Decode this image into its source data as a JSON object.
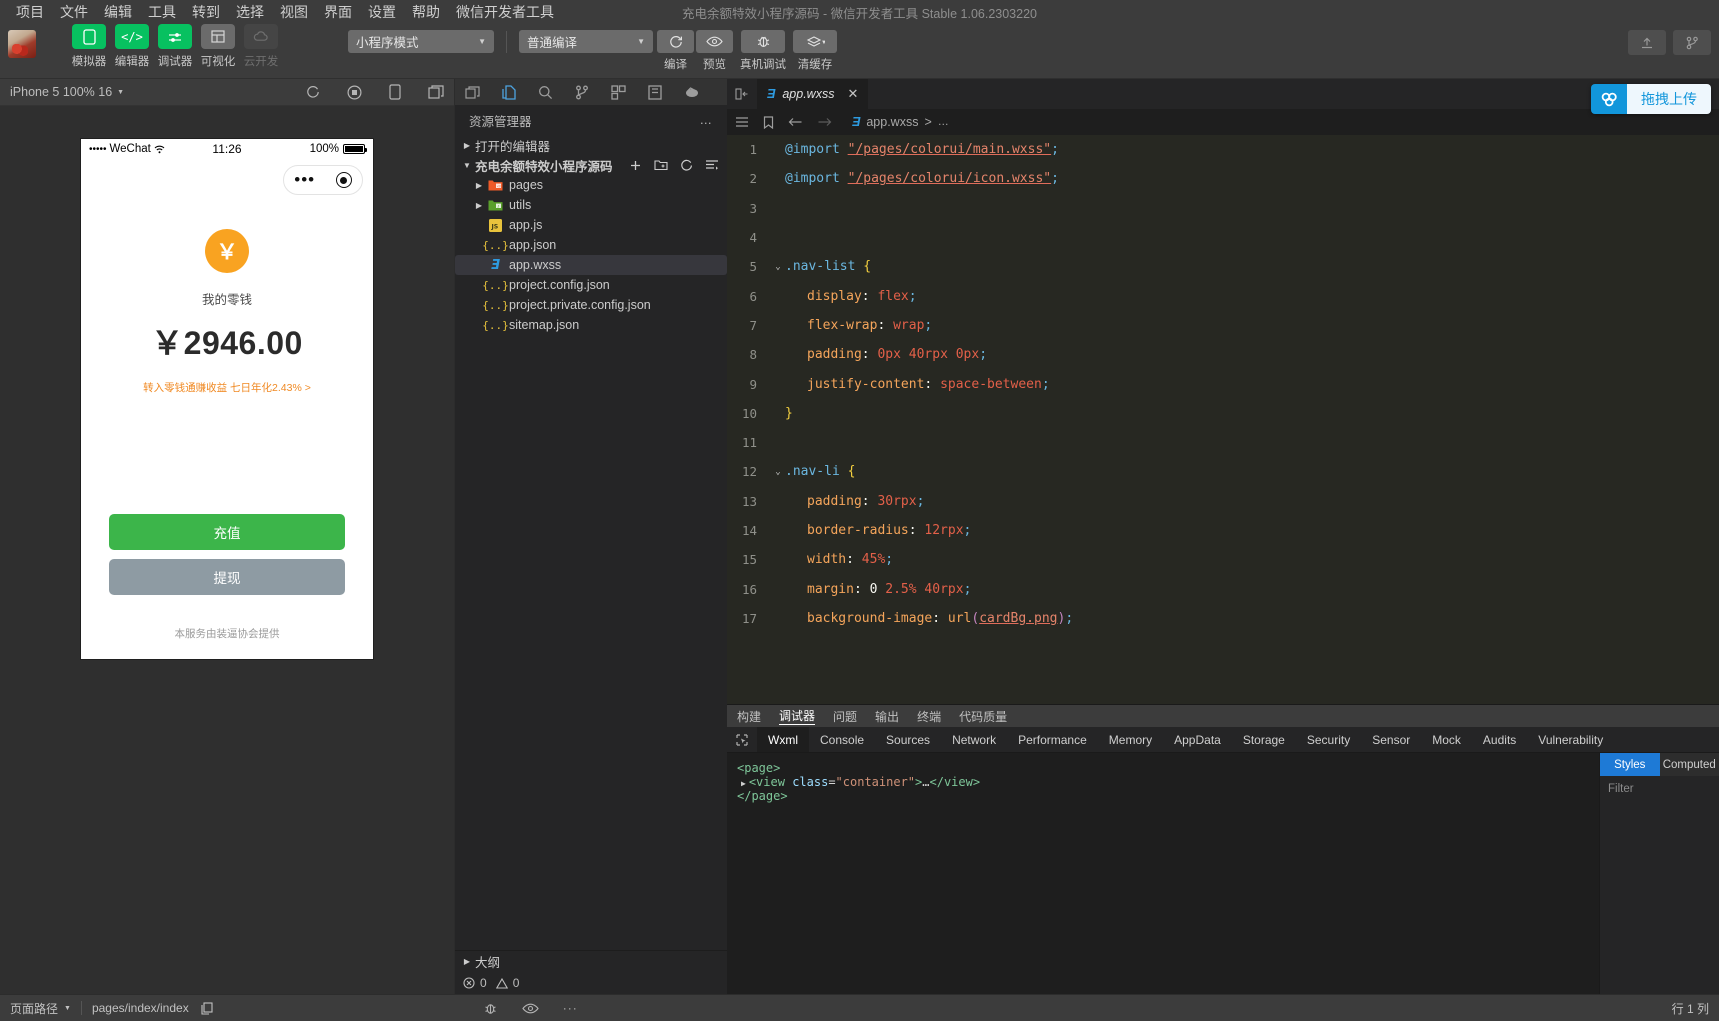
{
  "window": {
    "title": "充电余额特效小程序源码 - 微信开发者工具 Stable 1.06.2303220"
  },
  "menubar": {
    "items": [
      "项目",
      "文件",
      "编辑",
      "工具",
      "转到",
      "选择",
      "视图",
      "界面",
      "设置",
      "帮助",
      "微信开发者工具"
    ]
  },
  "toolbar": {
    "mode_buttons": [
      {
        "label": "模拟器",
        "icon": "phone-icon",
        "state": "active"
      },
      {
        "label": "编辑器",
        "icon": "code-icon",
        "state": "active"
      },
      {
        "label": "调试器",
        "icon": "sliders-icon",
        "state": "active"
      },
      {
        "label": "可视化",
        "icon": "layout-icon",
        "state": "gray"
      },
      {
        "label": "云开发",
        "icon": "cloud-icon",
        "state": "disabled"
      }
    ],
    "mode_select": {
      "value": "小程序模式"
    },
    "compile_select": {
      "value": "普通编译"
    },
    "actions": [
      {
        "label": "编译",
        "icon": "refresh-icon"
      },
      {
        "label": "预览",
        "icon": "eye-icon"
      },
      {
        "label": "真机调试",
        "icon": "bug-icon"
      },
      {
        "label": "清缓存",
        "icon": "layers-icon"
      }
    ],
    "right_icons": [
      "upload-icon",
      "branch-icon"
    ],
    "upload_pill": {
      "label": "拖拽上传",
      "icon": "cloud-upload-icon",
      "accent": "#1296db"
    }
  },
  "simulator": {
    "device": "iPhone 5 100% 16",
    "icons": [
      "refresh-icon",
      "record-icon",
      "rotate-icon",
      "copy-icon"
    ],
    "phone": {
      "status": {
        "carrier": "WeChat",
        "dots": "•••••",
        "time": "11:26",
        "battery": "100%"
      },
      "capsule": {
        "menu": "•••",
        "close": "target-icon"
      },
      "coin_symbol": "￥",
      "label": "我的零钱",
      "amount": "￥2946.00",
      "link": "转入零钱通赚收益 七日年化2.43% >",
      "primary_button": "充值",
      "secondary_button": "提现",
      "footer": "本服务由装逼协会提供",
      "colors": {
        "coin": "#f9a321",
        "primary": "#3cb54a",
        "secondary": "#8e9ba3",
        "link": "#f08a24"
      }
    }
  },
  "explorer": {
    "activity_icons": [
      "files-icon",
      "search-icon",
      "source-control-icon",
      "extensions-icon",
      "wxml-icon",
      "debug-console-icon"
    ],
    "title": "资源管理器",
    "more": "…",
    "sections": [
      {
        "label": "打开的编辑器",
        "expanded": false
      },
      {
        "label": "充电余额特效小程序源码",
        "expanded": true
      }
    ],
    "root_actions": [
      "new-file-icon",
      "new-folder-icon",
      "refresh-icon",
      "collapse-icon"
    ],
    "files": [
      {
        "name": "pages",
        "type": "folder",
        "icon": "folder-pages-icon",
        "indent": 1,
        "expanded": false
      },
      {
        "name": "utils",
        "type": "folder",
        "icon": "folder-utils-icon",
        "indent": 1,
        "expanded": false
      },
      {
        "name": "app.js",
        "type": "file",
        "icon": "js-icon",
        "indent": 1
      },
      {
        "name": "app.json",
        "type": "file",
        "icon": "json-icon",
        "indent": 1
      },
      {
        "name": "app.wxss",
        "type": "file",
        "icon": "wxss-icon",
        "indent": 1,
        "selected": true
      },
      {
        "name": "project.config.json",
        "type": "file",
        "icon": "json-icon",
        "indent": 1
      },
      {
        "name": "project.private.config.json",
        "type": "file",
        "icon": "json-icon",
        "indent": 1
      },
      {
        "name": "sitemap.json",
        "type": "file",
        "icon": "json-icon",
        "indent": 1
      }
    ],
    "outline": {
      "label": "大纲",
      "expanded": false
    },
    "problems": {
      "errors": "0",
      "warnings": "0"
    }
  },
  "editor": {
    "tab": {
      "name": "app.wxss",
      "icon": "wxss-icon",
      "close": "✕"
    },
    "split_icon": "split-editor-icon",
    "breadcrumb_icons": [
      "outline-icon",
      "bookmark-icon",
      "back-arrow-icon",
      "forward-arrow-icon"
    ],
    "breadcrumb": {
      "file": "app.wxss",
      "sep": ">",
      "rest": "…"
    },
    "lines": [
      {
        "n": "1",
        "tokens": [
          {
            "t": "@import",
            "c": "k-at"
          },
          {
            "t": " ",
            "c": "k-val2"
          },
          {
            "t": "\"/pages/colorui/main.wxss\"",
            "c": "k-str"
          },
          {
            "t": ";",
            "c": "k-punc"
          }
        ]
      },
      {
        "n": "2",
        "tokens": [
          {
            "t": "@import",
            "c": "k-at"
          },
          {
            "t": " ",
            "c": "k-val2"
          },
          {
            "t": "\"/pages/colorui/icon.wxss\"",
            "c": "k-str"
          },
          {
            "t": ";",
            "c": "k-punc"
          }
        ]
      },
      {
        "n": "3",
        "tokens": []
      },
      {
        "n": "4",
        "tokens": []
      },
      {
        "n": "5",
        "fold": "⌄",
        "tokens": [
          {
            "t": ".nav-list",
            "c": "k-sel"
          },
          {
            "t": " ",
            "c": "k-val2"
          },
          {
            "t": "{",
            "c": "k-brace"
          }
        ]
      },
      {
        "n": "6",
        "indent": 1,
        "tokens": [
          {
            "t": "display",
            "c": "k-prop"
          },
          {
            "t": ": ",
            "c": "k-val2"
          },
          {
            "t": "flex",
            "c": "k-val"
          },
          {
            "t": ";",
            "c": "k-punc"
          }
        ]
      },
      {
        "n": "7",
        "indent": 1,
        "tokens": [
          {
            "t": "flex-wrap",
            "c": "k-prop"
          },
          {
            "t": ": ",
            "c": "k-val2"
          },
          {
            "t": "wrap",
            "c": "k-val"
          },
          {
            "t": ";",
            "c": "k-punc"
          }
        ]
      },
      {
        "n": "8",
        "indent": 1,
        "tokens": [
          {
            "t": "padding",
            "c": "k-prop"
          },
          {
            "t": ": ",
            "c": "k-val2"
          },
          {
            "t": "0px 40rpx 0px",
            "c": "k-num"
          },
          {
            "t": ";",
            "c": "k-punc"
          }
        ]
      },
      {
        "n": "9",
        "indent": 1,
        "tokens": [
          {
            "t": "justify-content",
            "c": "k-prop"
          },
          {
            "t": ": ",
            "c": "k-val2"
          },
          {
            "t": "space-between",
            "c": "k-val"
          },
          {
            "t": ";",
            "c": "k-punc"
          }
        ]
      },
      {
        "n": "10",
        "tokens": [
          {
            "t": "}",
            "c": "k-brace"
          }
        ]
      },
      {
        "n": "11",
        "tokens": []
      },
      {
        "n": "12",
        "fold": "⌄",
        "tokens": [
          {
            "t": ".nav-li",
            "c": "k-sel"
          },
          {
            "t": " ",
            "c": "k-val2"
          },
          {
            "t": "{",
            "c": "k-brace"
          }
        ]
      },
      {
        "n": "13",
        "indent": 1,
        "tokens": [
          {
            "t": "padding",
            "c": "k-prop"
          },
          {
            "t": ": ",
            "c": "k-val2"
          },
          {
            "t": "30rpx",
            "c": "k-num"
          },
          {
            "t": ";",
            "c": "k-punc"
          }
        ]
      },
      {
        "n": "14",
        "indent": 1,
        "tokens": [
          {
            "t": "border-radius",
            "c": "k-prop"
          },
          {
            "t": ": ",
            "c": "k-val2"
          },
          {
            "t": "12rpx",
            "c": "k-num"
          },
          {
            "t": ";",
            "c": "k-punc"
          }
        ]
      },
      {
        "n": "15",
        "indent": 1,
        "tokens": [
          {
            "t": "width",
            "c": "k-prop"
          },
          {
            "t": ": ",
            "c": "k-val2"
          },
          {
            "t": "45%",
            "c": "k-num"
          },
          {
            "t": ";",
            "c": "k-punc"
          }
        ]
      },
      {
        "n": "16",
        "indent": 1,
        "tokens": [
          {
            "t": "margin",
            "c": "k-prop"
          },
          {
            "t": ": ",
            "c": "k-val2"
          },
          {
            "t": "0 ",
            "c": "k-val2"
          },
          {
            "t": "2.5%",
            "c": "k-num"
          },
          {
            "t": " ",
            "c": "k-val2"
          },
          {
            "t": "40rpx",
            "c": "k-num"
          },
          {
            "t": ";",
            "c": "k-punc"
          }
        ]
      },
      {
        "n": "17",
        "indent": 1,
        "tokens": [
          {
            "t": "background-image",
            "c": "k-prop"
          },
          {
            "t": ": ",
            "c": "k-val2"
          },
          {
            "t": "url",
            "c": "k-fn"
          },
          {
            "t": "(",
            "c": "k-paren"
          },
          {
            "t": "cardBg.png",
            "c": "k-url"
          },
          {
            "t": ")",
            "c": "k-paren"
          },
          {
            "t": ";",
            "c": "k-punc"
          }
        ]
      }
    ]
  },
  "debugger": {
    "panel_tabs": [
      {
        "label": "构建"
      },
      {
        "label": "调试器",
        "active": true
      },
      {
        "label": "问题"
      },
      {
        "label": "输出"
      },
      {
        "label": "终端"
      },
      {
        "label": "代码质量"
      }
    ],
    "devtools_picker": "inspect-icon",
    "devtools_tabs": [
      {
        "label": "Wxml",
        "active": true
      },
      {
        "label": "Console"
      },
      {
        "label": "Sources"
      },
      {
        "label": "Network"
      },
      {
        "label": "Performance"
      },
      {
        "label": "Memory"
      },
      {
        "label": "AppData"
      },
      {
        "label": "Storage"
      },
      {
        "label": "Security"
      },
      {
        "label": "Sensor"
      },
      {
        "label": "Mock"
      },
      {
        "label": "Audits"
      },
      {
        "label": "Vulnerability"
      }
    ],
    "dom_lines": [
      {
        "indent": 0,
        "text": "<page>",
        "arrow": false
      },
      {
        "indent": 1,
        "text": "<view class=\"container\">…</view>",
        "arrow": true
      },
      {
        "indent": 0,
        "text": "</page>",
        "arrow": false
      }
    ],
    "side_tabs": [
      {
        "label": "Styles",
        "active": true
      },
      {
        "label": "Computed"
      }
    ],
    "filter_placeholder": "Filter"
  },
  "statusbar": {
    "page_path_label": "页面路径",
    "path": "pages/index/index",
    "copy_icon": "copy-icon",
    "icons": [
      "bug-icon",
      "eye-icon",
      "more-icon"
    ],
    "cursor": "行 1 列"
  }
}
